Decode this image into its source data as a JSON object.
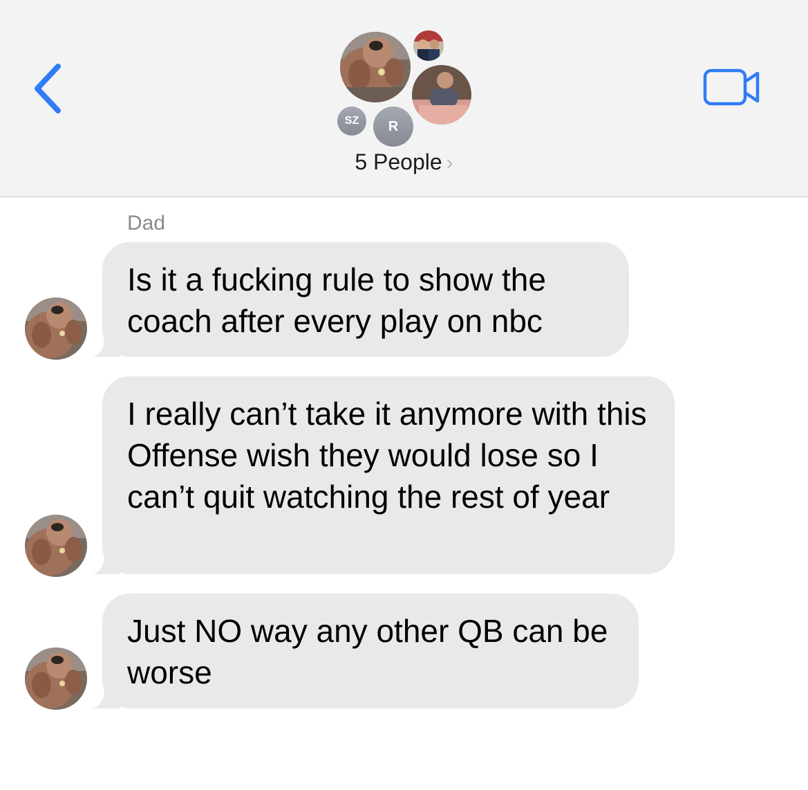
{
  "header": {
    "back_icon": "chevron-left-icon",
    "video_icon": "video-camera-icon",
    "group_title": "5 People",
    "group_chevron": "›",
    "participants": [
      {
        "type": "photo",
        "icon": "dog-avatar-icon"
      },
      {
        "type": "photo",
        "icon": "person-avatar-icon"
      },
      {
        "type": "photo",
        "icon": "person-avatar-icon"
      },
      {
        "type": "initials",
        "initials": "SZ"
      },
      {
        "type": "initials",
        "initials": "R"
      }
    ],
    "accent_color": "#2f7cf6"
  },
  "conversation": {
    "sender_name": "Dad",
    "bubble_color": "#e9e9eb",
    "messages": [
      {
        "text": "Is it a fucking rule to show the coach after every play on nbc"
      },
      {
        "text": "I really can’t take it anymore with this Offense wish they would lose so I can’t quit watching the rest of year"
      },
      {
        "text": "Just NO way any other QB can be worse"
      }
    ]
  }
}
